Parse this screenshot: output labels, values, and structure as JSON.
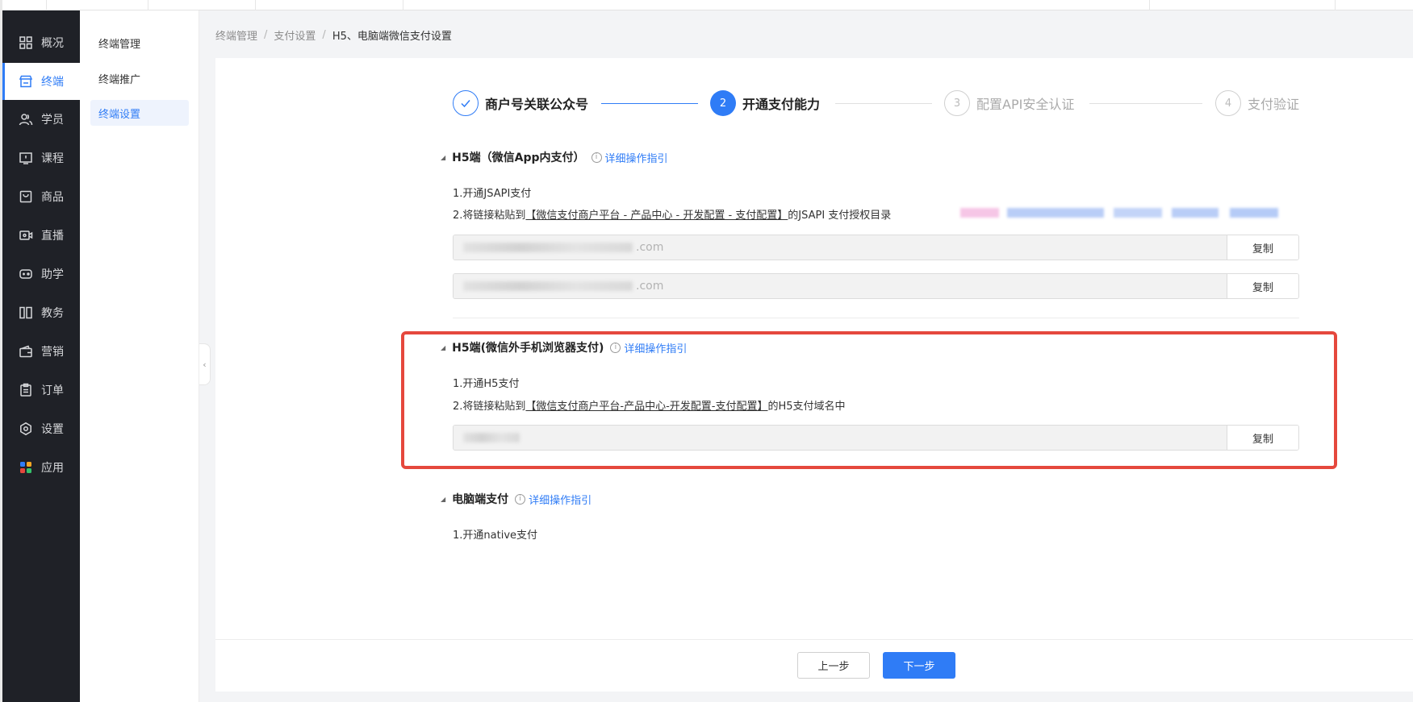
{
  "nav": {
    "items": [
      {
        "label": "概况",
        "icon": "grid-icon"
      },
      {
        "label": "终端",
        "icon": "store-icon"
      },
      {
        "label": "学员",
        "icon": "users-icon"
      },
      {
        "label": "课程",
        "icon": "course-icon"
      },
      {
        "label": "商品",
        "icon": "goods-icon"
      },
      {
        "label": "直播",
        "icon": "live-icon"
      },
      {
        "label": "助学",
        "icon": "gamepad-icon"
      },
      {
        "label": "教务",
        "icon": "book-icon"
      },
      {
        "label": "营销",
        "icon": "wallet-icon"
      },
      {
        "label": "订单",
        "icon": "clipboard-icon"
      },
      {
        "label": "设置",
        "icon": "gear-icon"
      },
      {
        "label": "应用",
        "icon": "apps-icon"
      }
    ],
    "active_index": 1,
    "accent": "#2f7cf6"
  },
  "subnav": {
    "items": [
      "终端管理",
      "终端推广",
      "终端设置"
    ],
    "active_index": 2
  },
  "breadcrumb": {
    "items": [
      "终端管理",
      "支付设置"
    ],
    "current": "H5、电脑端微信支付设置",
    "separator": "/"
  },
  "steps": [
    {
      "number": "",
      "label": "商户号关联公众号",
      "state": "done"
    },
    {
      "number": "2",
      "label": "开通支付能力",
      "state": "current"
    },
    {
      "number": "3",
      "label": "配置API安全认证",
      "state": "todo"
    },
    {
      "number": "4",
      "label": "支付验证",
      "state": "todo"
    }
  ],
  "sections": {
    "wechat_inapp": {
      "title": "H5端（微信App内支付）",
      "guide": "详细操作指引",
      "line1": "1.开通JSAPI支付",
      "line2_prefix": "2.将链接粘贴到",
      "line2_link": "【微信支付商户平台 - 产品中心 - 开发配置 - 支付配置】",
      "line2_suffix": "的JSAPI 支付授权目录",
      "field1_value": ".com",
      "field2_value": ".com",
      "copy_label": "复制"
    },
    "wechat_outside": {
      "title": "H5端(微信外手机浏览器支付)",
      "guide": "详细操作指引",
      "line1": "1.开通H5支付",
      "line2_prefix": "2.将链接粘贴到",
      "line2_link": "【微信支付商户平台-产品中心-开发配置-支付配置】",
      "line2_suffix": "的H5支付域名中",
      "field_value": "",
      "copy_label": "复制"
    },
    "pc": {
      "title": "电脑端支付",
      "guide": "详细操作指引",
      "line1": "1.开通native支付"
    }
  },
  "footer": {
    "prev_label": "上一步",
    "next_label": "下一步"
  },
  "colors": {
    "highlight_border": "#e5483d",
    "nav_bg": "#1f2127"
  }
}
